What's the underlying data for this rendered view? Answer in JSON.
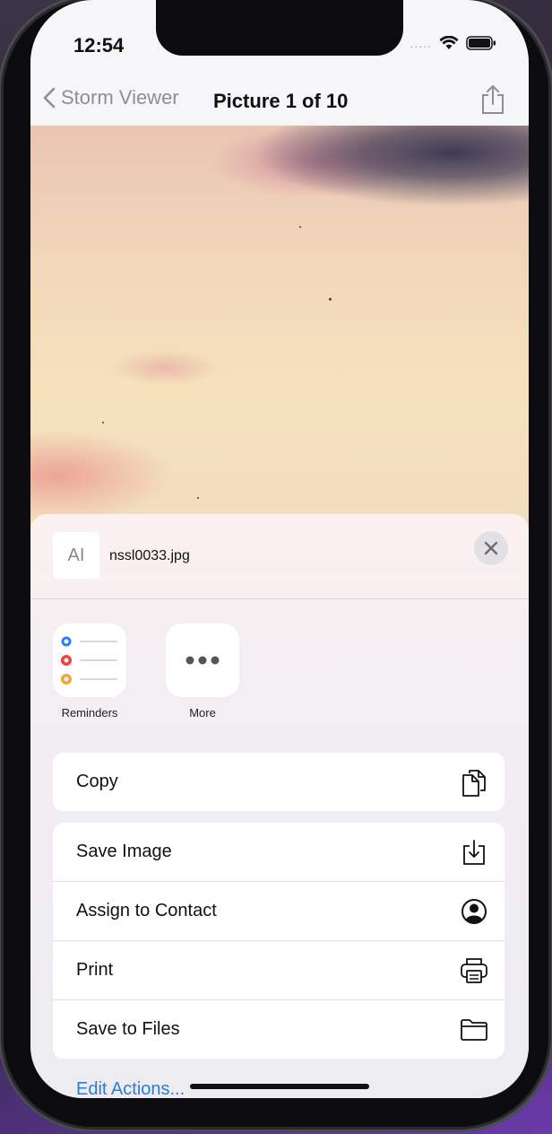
{
  "status_bar": {
    "time": "12:54",
    "signal": "....."
  },
  "nav": {
    "back_label": "Storm Viewer",
    "title": "Picture 1 of 10"
  },
  "share_sheet": {
    "file_thumbnail_text": "AI",
    "filename": "nssl0033.jpg",
    "apps": [
      {
        "label": "Reminders",
        "icon": "reminders-icon"
      },
      {
        "label": "More",
        "icon": "more-icon"
      }
    ],
    "action_groups": [
      [
        {
          "label": "Copy",
          "icon": "copy-icon"
        }
      ],
      [
        {
          "label": "Save Image",
          "icon": "save-image-icon"
        },
        {
          "label": "Assign to Contact",
          "icon": "contact-icon"
        },
        {
          "label": "Print",
          "icon": "printer-icon"
        },
        {
          "label": "Save to Files",
          "icon": "folder-icon"
        }
      ]
    ],
    "edit_actions": "Edit Actions..."
  },
  "colors": {
    "accent": "#2d7be0",
    "reminder_blue": "#2f7df6",
    "reminder_red": "#e8453c",
    "reminder_orange": "#f3a33a"
  }
}
